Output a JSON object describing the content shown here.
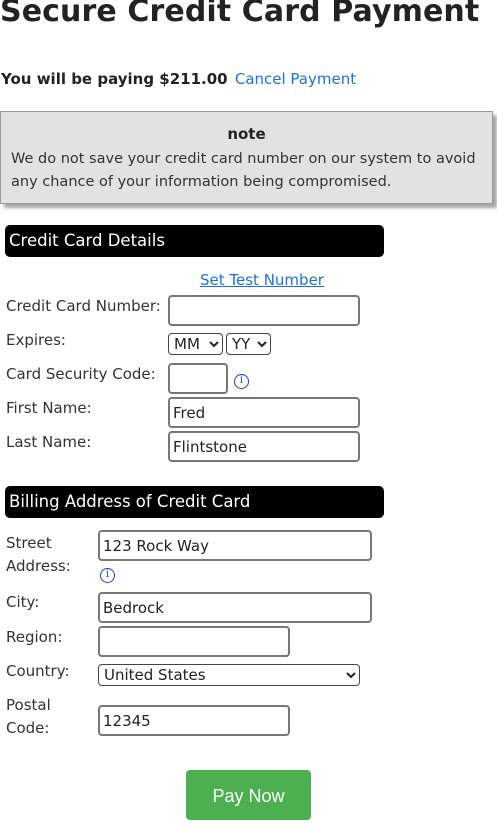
{
  "page": {
    "title": "Secure Credit Card Payment",
    "paying_prefix": "You will be paying $211.00",
    "cancel_link": "Cancel Payment"
  },
  "note": {
    "heading": "note",
    "text": "We do not save your credit card number on our system to avoid any chance of your information being compromised."
  },
  "card_section": {
    "heading": "Credit Card Details",
    "set_test_number": "Set Test Number",
    "card_number_label": "Credit Card Number:",
    "card_number_value": "",
    "expires_label": "Expires:",
    "expires_month": "MM",
    "expires_year": "YY",
    "security_code_label": "Card Security Code:",
    "security_code_value": "",
    "first_name_label": "First Name:",
    "first_name_value": "Fred",
    "last_name_label": "Last Name:",
    "last_name_value": "Flintstone"
  },
  "billing_section": {
    "heading": "Billing Address of Credit Card",
    "street_label": "Street Address:",
    "street_value": "123 Rock Way",
    "city_label": "City:",
    "city_value": "Bedrock",
    "region_label": "Region:",
    "region_value": "",
    "country_label": "Country:",
    "country_value": "United States",
    "postal_label": "Postal Code:",
    "postal_value": "12345"
  },
  "actions": {
    "pay_now": "Pay Now"
  },
  "colors": {
    "link": "#1a73d9",
    "pay_button": "#4caf50",
    "section_bar": "#000000",
    "note_bg": "#e2e2e2"
  }
}
